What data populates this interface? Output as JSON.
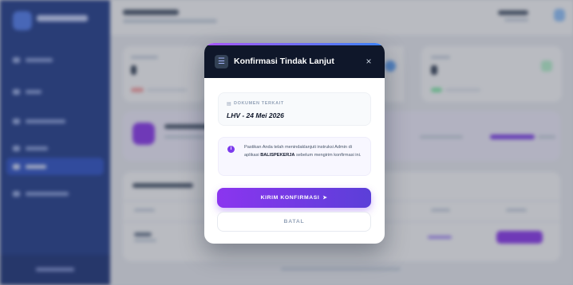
{
  "modal": {
    "title": "Konfirmasi Tindak Lanjut",
    "header_icon": "list-icon",
    "close_icon": "close-icon",
    "document": {
      "label": "DOKUMEN TERKAIT",
      "value": "LHV - 24 Mei 2026"
    },
    "info": {
      "before": "Pastikan Anda telah menindaklanjuti instruksi Admin di aplikasi ",
      "emphasis": "BALISPEKERJA",
      "after": " sebelum mengirim konfirmasi ini."
    },
    "primary_button": "KIRIM KONFIRMASI",
    "primary_button_icon": "send-icon",
    "cancel_button": "BATAL"
  },
  "colors": {
    "modal_header": "#0f172a",
    "accent_purple": "#8b35ef",
    "accent_blue": "#3b82f6",
    "sidebar": "#1e3a8a",
    "info_icon": "#7c3aed"
  }
}
